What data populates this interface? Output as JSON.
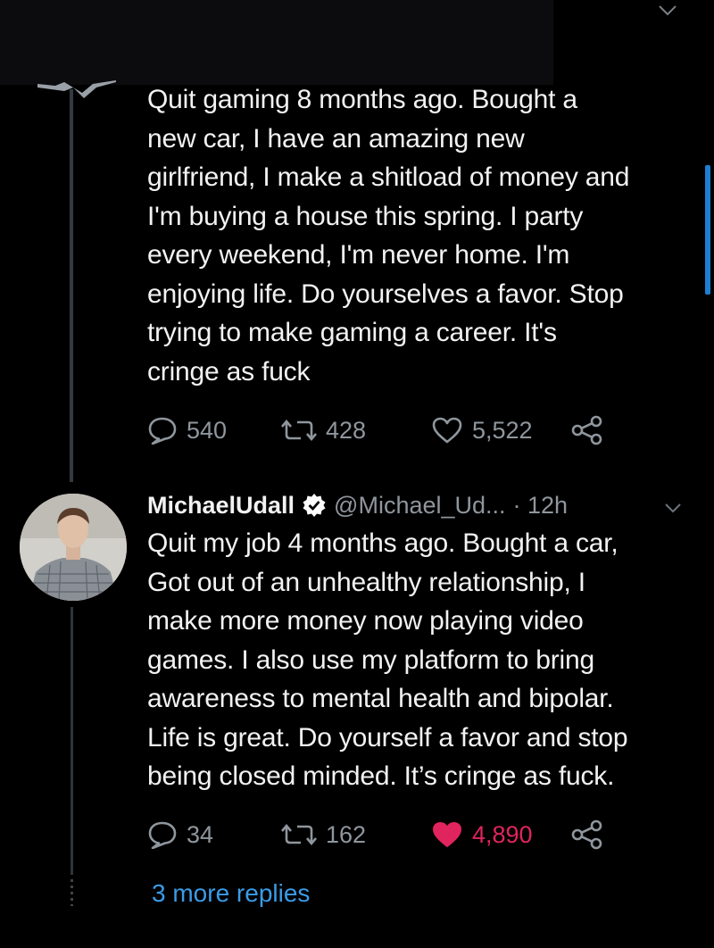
{
  "previous_tweet": {
    "text": "Quit gaming 8 months ago. Bought a\nnew car, I have an amazing new\ngirlfriend, I make a shitload of money and\nI'm buying a house this spring. I party\nevery weekend, I'm never home. I'm\nenjoying life. Do yourselves a favor. Stop\ntrying to make gaming a career. It's\ncringe as fuck",
    "replies": "540",
    "retweets": "428",
    "likes": "5,522"
  },
  "reply_tweet": {
    "name": "MichaelUdall",
    "handle": "@Michael_Ud...",
    "time": "· 12h",
    "verified": true,
    "text": "Quit my job 4 months ago. Bought a car,\nGot out of an unhealthy relationship, I\nmake more money now playing video\ngames. I also use my platform to bring\nawareness to mental health and bipolar.\nLife is great. Do yourself a favor and stop\nbeing closed minded. It’s cringe as fuck.",
    "replies": "34",
    "retweets": "162",
    "likes": "4,890",
    "liked": true
  },
  "more_replies": "3 more replies",
  "colors": {
    "background": "#000000",
    "text": "#f2f2f2",
    "muted": "#8f969d",
    "link": "#3a9ce8",
    "like": "#e0245e",
    "verified": "#ffffff"
  }
}
